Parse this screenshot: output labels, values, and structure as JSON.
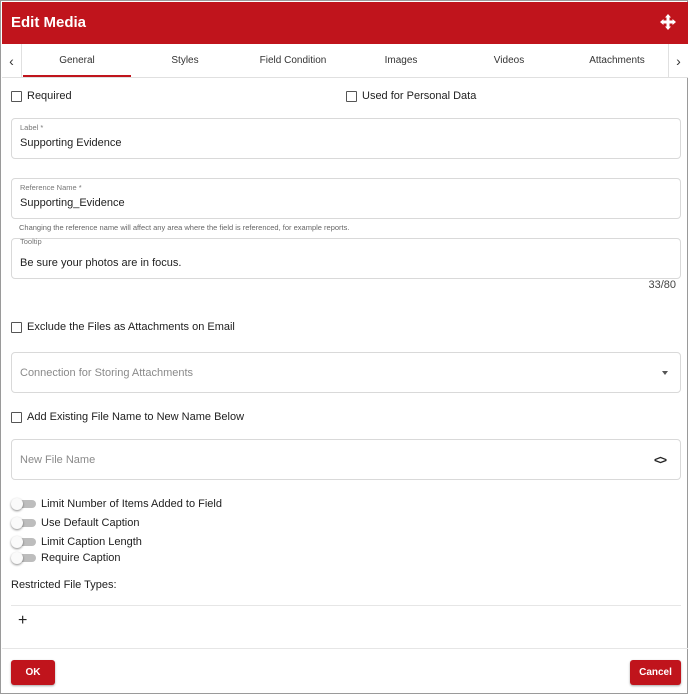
{
  "dialog": {
    "title": "Edit Media"
  },
  "tabs": [
    "General",
    "Styles",
    "Field Condition",
    "Images",
    "Videos",
    "Attachments"
  ],
  "active_tab": "General",
  "checkboxes": {
    "required": "Required",
    "personal_data": "Used for Personal Data",
    "exclude_files": "Exclude the Files as Attachments on Email",
    "add_existing": "Add Existing File Name to New Name Below"
  },
  "label_field": {
    "label": "Label *",
    "value": "Supporting Evidence"
  },
  "reference_field": {
    "label": "Reference Name *",
    "value": "Supporting_Evidence"
  },
  "reference_helper": "Changing the reference name will affect any area where the field is referenced, for example reports.",
  "tooltip_field": {
    "label": "Tooltip",
    "value": "Be sure your photos are in focus.",
    "counter": "33/80"
  },
  "connection_select": {
    "placeholder": "Connection for Storing Attachments"
  },
  "new_file_name": {
    "placeholder": "New File Name",
    "code_icon": "<>"
  },
  "toggles": [
    "Limit Number of Items Added to Field",
    "Use Default Caption",
    "Limit Caption Length",
    "Require Caption"
  ],
  "restricted": {
    "label": "Restricted File Types:",
    "add": "+"
  },
  "buttons": {
    "ok": "OK",
    "cancel": "Cancel"
  },
  "colors": {
    "accent": "#c0141c",
    "border": "#d9d9d9"
  },
  "icons": {
    "move": "move-arrows-icon",
    "left": "chevron-left-icon",
    "right": "chevron-right-icon",
    "dropdown": "caret-down-icon",
    "code": "code-brackets-icon",
    "add": "plus-icon"
  }
}
